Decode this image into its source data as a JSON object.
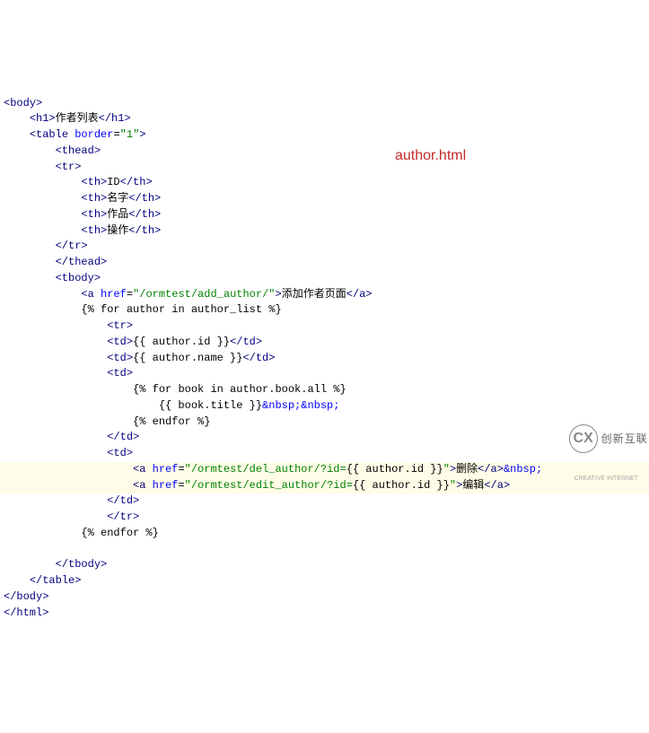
{
  "annotation": {
    "filename_label": "author.html"
  },
  "lines": {
    "l01": {
      "a": "<body>",
      "b": "",
      "c": ""
    },
    "l02": {
      "indent": "    ",
      "a": "<h1>",
      "t": "作者列表",
      "b": "</h1>"
    },
    "l03": {
      "indent": "    ",
      "a": "<table",
      "sp": " ",
      "attr": "border",
      "eq": "=",
      "q": "\"",
      "v": "1",
      "q2": "\"",
      "b": ">"
    },
    "l04": {
      "indent": "        ",
      "a": "<thead>"
    },
    "l05": {
      "indent": "        ",
      "a": "<tr>"
    },
    "l06": {
      "indent": "            ",
      "a": "<th>",
      "t": "ID",
      "b": "</th>"
    },
    "l07": {
      "indent": "            ",
      "a": "<th>",
      "t": "名字",
      "b": "</th>"
    },
    "l08": {
      "indent": "            ",
      "a": "<th>",
      "t": "作品",
      "b": "</th>"
    },
    "l09": {
      "indent": "            ",
      "a": "<th>",
      "t": "操作",
      "b": "</th>"
    },
    "l10": {
      "indent": "        ",
      "a": "</tr>"
    },
    "l11": {
      "indent": "        ",
      "a": "</thead>"
    },
    "l12": {
      "indent": "        ",
      "a": "<tbody>"
    },
    "l13": {
      "indent": "            ",
      "a": "<a",
      "sp": " ",
      "attr": "href",
      "eq": "=",
      "q": "\"",
      "v": "/ormtest/add_author/",
      "q2": "\"",
      "b": ">",
      "t": "添加作者页面",
      "c": "</a>"
    },
    "l14": {
      "indent": "            ",
      "d": "{% for author in author_list %}"
    },
    "l15": {
      "indent": "                ",
      "a": "<tr>"
    },
    "l16": {
      "indent": "                ",
      "a": "<td>",
      "d": "{{ author.id }}",
      "b": "</td>"
    },
    "l17": {
      "indent": "                ",
      "a": "<td>",
      "d": "{{ author.name }}",
      "b": "</td>"
    },
    "l18": {
      "indent": "                ",
      "a": "<td>"
    },
    "l19": {
      "indent": "                    ",
      "d": "{% for book in author.book.all %}"
    },
    "l20": {
      "indent": "                        ",
      "d": "{{ book.title }}",
      "ent": "&nbsp;&nbsp;"
    },
    "l21": {
      "indent": "                    ",
      "d": "{% endfor %}"
    },
    "l22": {
      "indent": "                ",
      "a": "</td>"
    },
    "l23": {
      "indent": "                ",
      "a": "<td>"
    },
    "l24": {
      "indent": "                    ",
      "a": "<a",
      "sp": " ",
      "attr": "href",
      "eq": "=",
      "q": "\"",
      "v1": "/ormtest/del_author/?id=",
      "d": "{{ author.id }}",
      "q2": "\"",
      "b": ">",
      "t": "删除",
      "c": "</a>",
      "ent": "&nbsp;"
    },
    "l25": {
      "indent": "                    ",
      "a": "<a",
      "sp": " ",
      "attr": "href",
      "eq": "=",
      "q": "\"",
      "v1": "/ormtest/edit_author/?id=",
      "d": "{{ author.id }}",
      "q2": "\"",
      "b": ">",
      "t": "编辑",
      "c": "</a>"
    },
    "l26": {
      "indent": "                ",
      "a": "</td>"
    },
    "l27": {
      "indent": "                ",
      "a": "</tr>"
    },
    "l28": {
      "indent": "            ",
      "d": "{% endfor %}"
    },
    "l29": "",
    "l30": {
      "indent": "        ",
      "a": "</tbody>"
    },
    "l31": {
      "indent": "    ",
      "a": "</table>"
    },
    "l32": {
      "indent": "",
      "a": "</body>"
    },
    "l33": {
      "indent": "",
      "a": "</html>"
    }
  },
  "logo": {
    "brand": "创新互联",
    "mark": "CX",
    "sub": "CREATIVE INTERNET"
  }
}
